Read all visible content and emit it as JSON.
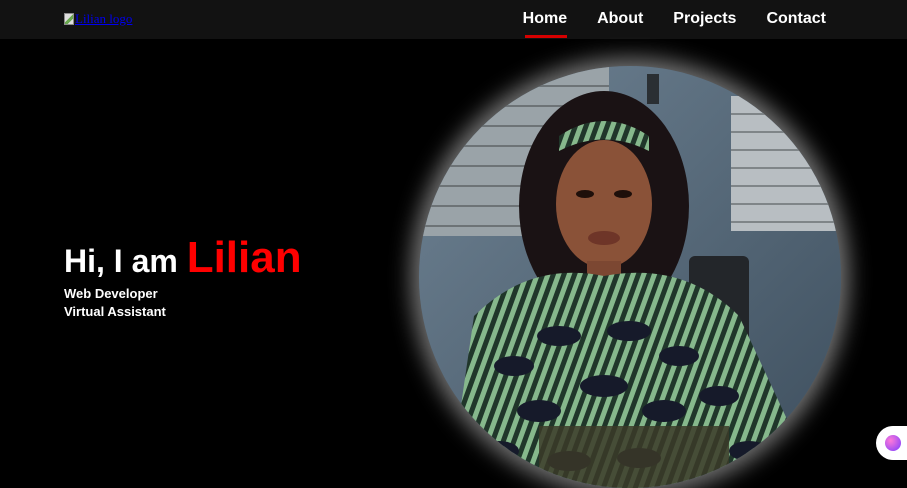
{
  "nav": {
    "logo_alt": "Lilian logo",
    "links": [
      {
        "label": "Home",
        "active": true
      },
      {
        "label": "About",
        "active": false
      },
      {
        "label": "Projects",
        "active": false
      },
      {
        "label": "Contact",
        "active": false
      }
    ]
  },
  "hero": {
    "greeting": "Hi, I am",
    "name": "Lilian",
    "roles": [
      "Web Developer",
      "Virtual Assistant"
    ]
  },
  "colors": {
    "accent": "#ff0000",
    "nav_bg": "#121212",
    "page_bg": "#000000"
  },
  "icons": {
    "widget": "brain-icon"
  }
}
